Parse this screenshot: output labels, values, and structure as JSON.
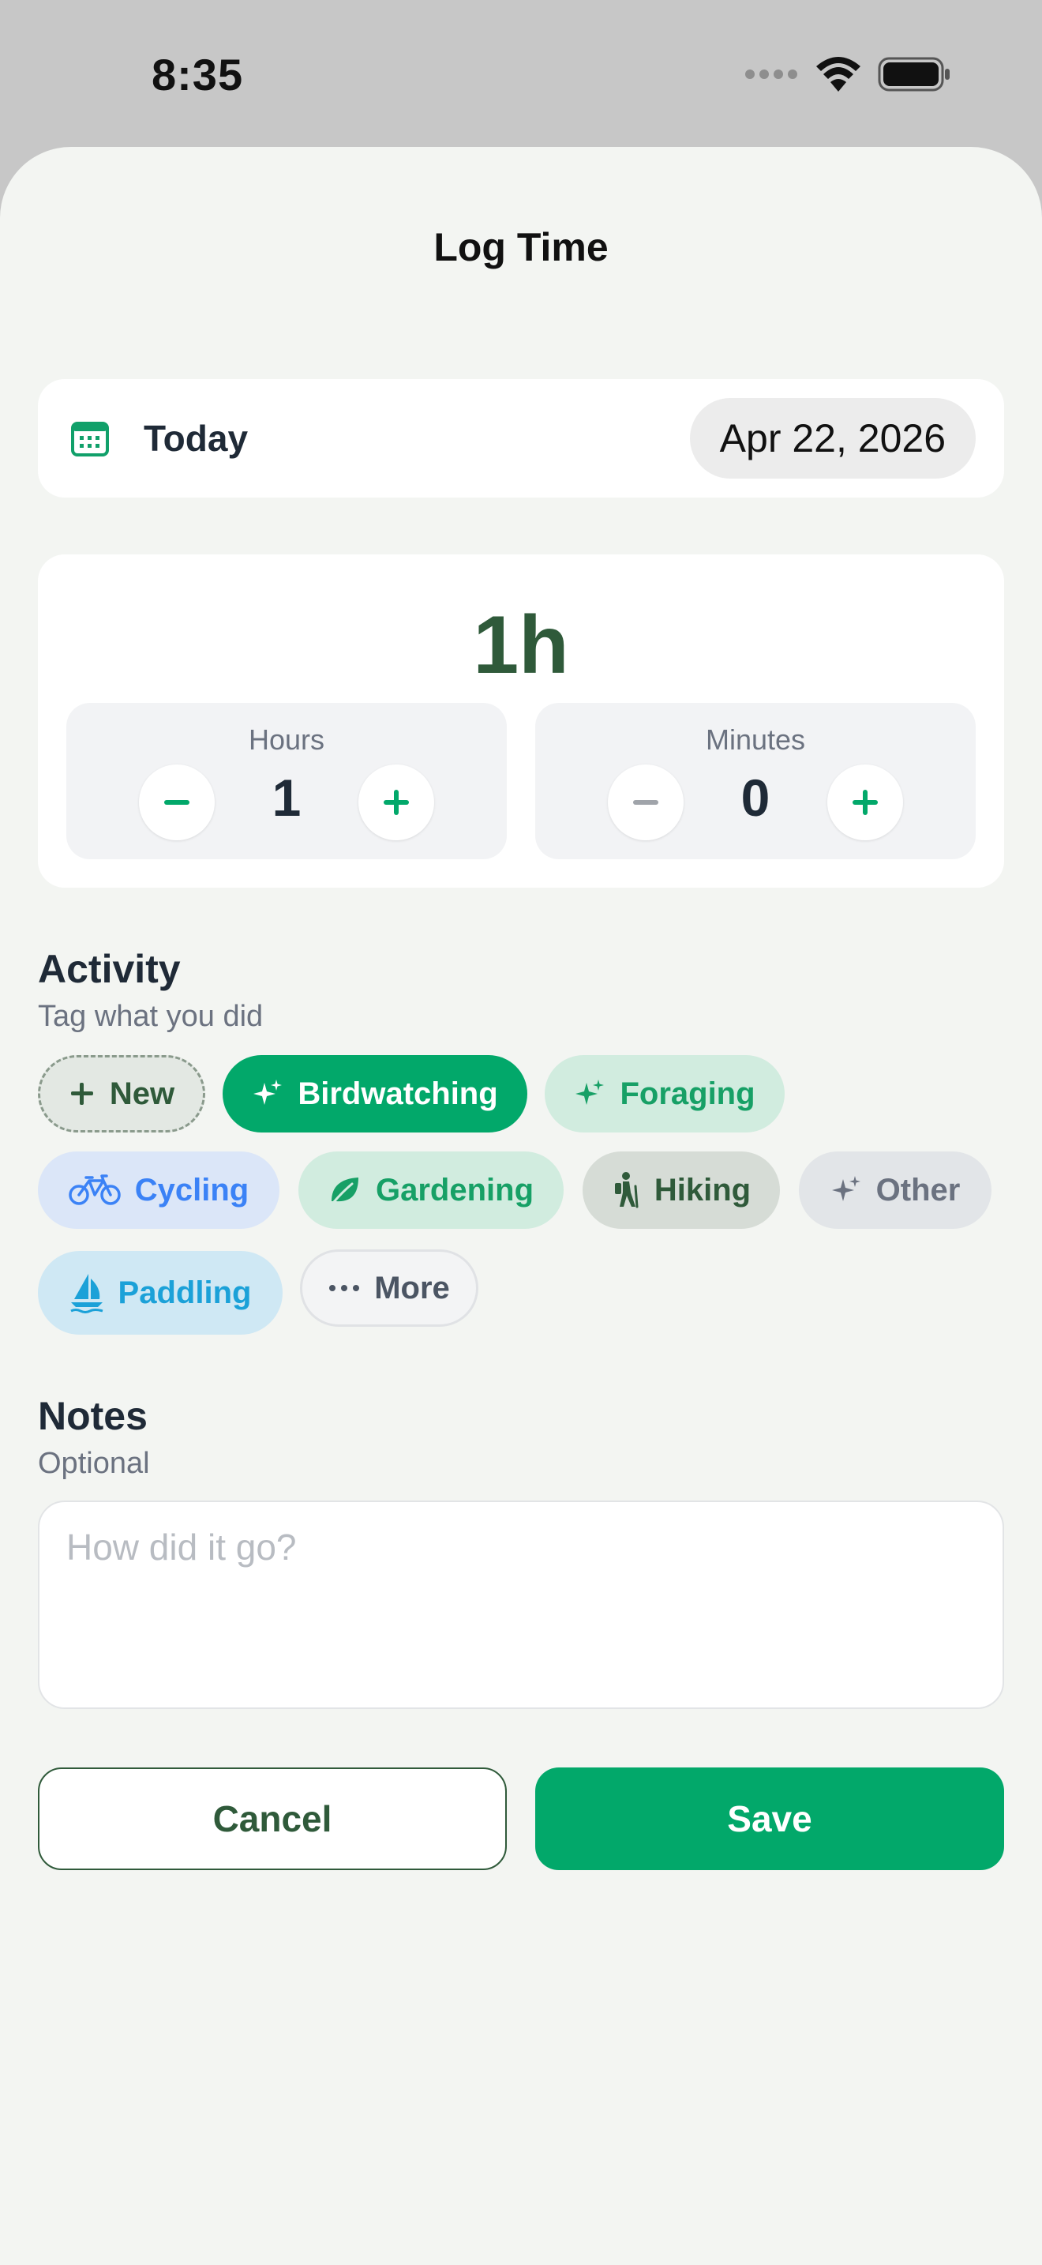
{
  "status_bar": {
    "time": "8:35"
  },
  "sheet": {
    "title": "Log Time"
  },
  "date_row": {
    "label": "Today",
    "date": "Apr 22, 2026"
  },
  "duration": {
    "display": "1h",
    "hours": {
      "label": "Hours",
      "value": "1"
    },
    "minutes": {
      "label": "Minutes",
      "value": "0"
    }
  },
  "activity": {
    "heading": "Activity",
    "subheading": "Tag what you did",
    "chips": [
      {
        "label": "New",
        "icon": "plus-icon",
        "selected": false
      },
      {
        "label": "Birdwatching",
        "icon": "sparkle-icon",
        "selected": true
      },
      {
        "label": "Foraging",
        "icon": "sparkle-icon",
        "selected": false
      },
      {
        "label": "Cycling",
        "icon": "bicycle-icon",
        "selected": false
      },
      {
        "label": "Gardening",
        "icon": "leaf-icon",
        "selected": false
      },
      {
        "label": "Hiking",
        "icon": "hiker-icon",
        "selected": false
      },
      {
        "label": "Other",
        "icon": "sparkle-icon",
        "selected": false
      },
      {
        "label": "Paddling",
        "icon": "sailboat-icon",
        "selected": false
      },
      {
        "label": "More",
        "icon": "ellipsis-icon",
        "selected": false
      }
    ]
  },
  "notes": {
    "heading": "Notes",
    "subheading": "Optional",
    "placeholder": "How did it go?",
    "value": ""
  },
  "buttons": {
    "cancel": "Cancel",
    "save": "Save"
  },
  "colors": {
    "accent_green": "#02a86a",
    "dark_green": "#2f5a3a",
    "sheet_bg": "#f3f5f2",
    "cycling_blue": "#3b82f6",
    "paddling_blue": "#1ba1d8"
  }
}
